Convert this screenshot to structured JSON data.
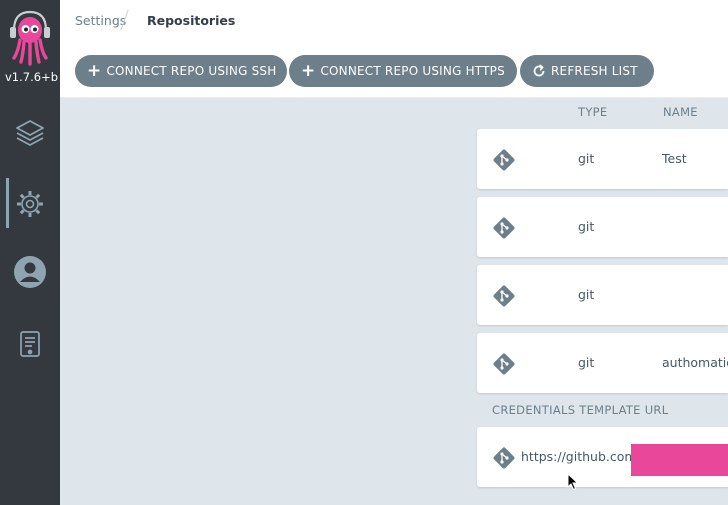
{
  "sidebar": {
    "version": "v1.7.6+b",
    "nav": [
      {
        "icon": "layers-icon",
        "active": false
      },
      {
        "icon": "gear-icon",
        "active": true
      },
      {
        "icon": "user-icon",
        "active": false
      },
      {
        "icon": "docs-icon",
        "active": false
      }
    ]
  },
  "breadcrumb": {
    "parent": "Settings",
    "current": "Repositories"
  },
  "toolbar": {
    "connect_ssh": "CONNECT REPO USING SSH",
    "connect_https": "CONNECT REPO USING HTTPS",
    "refresh": "REFRESH LIST"
  },
  "table": {
    "headers": {
      "type": "TYPE",
      "name": "NAME"
    },
    "rows": [
      {
        "type": "git",
        "name": "Test"
      },
      {
        "type": "git",
        "name": ""
      },
      {
        "type": "git",
        "name": ""
      },
      {
        "type": "git",
        "name": "authomatio"
      }
    ]
  },
  "credentials": {
    "header": "CREDENTIALS TEMPLATE URL",
    "rows": [
      {
        "url": "https://github.com/"
      }
    ]
  },
  "colors": {
    "sidebar_bg": "#33393e",
    "button_bg": "#6d7f8b",
    "page_bg": "#dee6eb",
    "redaction": "#e9489a",
    "logo_pink": "#e9489a"
  }
}
